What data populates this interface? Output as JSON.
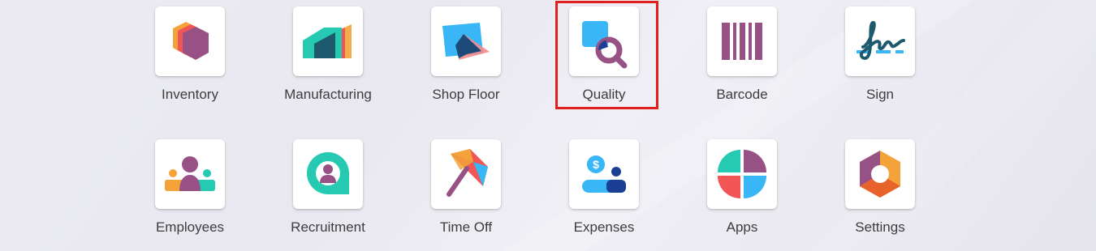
{
  "apps": [
    {
      "label": "Inventory",
      "icon": "inventory-icon"
    },
    {
      "label": "Manufacturing",
      "icon": "manufacturing-icon"
    },
    {
      "label": "Shop Floor",
      "icon": "shop-floor-icon"
    },
    {
      "label": "Quality",
      "icon": "quality-icon"
    },
    {
      "label": "Barcode",
      "icon": "barcode-icon"
    },
    {
      "label": "Sign",
      "icon": "sign-icon"
    },
    {
      "label": "Employees",
      "icon": "employees-icon"
    },
    {
      "label": "Recruitment",
      "icon": "recruitment-icon"
    },
    {
      "label": "Time Off",
      "icon": "time-off-icon"
    },
    {
      "label": "Expenses",
      "icon": "expenses-icon"
    },
    {
      "label": "Apps",
      "icon": "apps-icon"
    },
    {
      "label": "Settings",
      "icon": "settings-icon"
    }
  ],
  "highlighted_app": "Quality",
  "highlight_color": "#e0201c",
  "colors": {
    "purple": "#985184",
    "orange": "#f3a33a",
    "teal": "#26c9b1",
    "blue": "#38b6f5",
    "red": "#f15555",
    "dark_blue": "#1a3f94"
  }
}
